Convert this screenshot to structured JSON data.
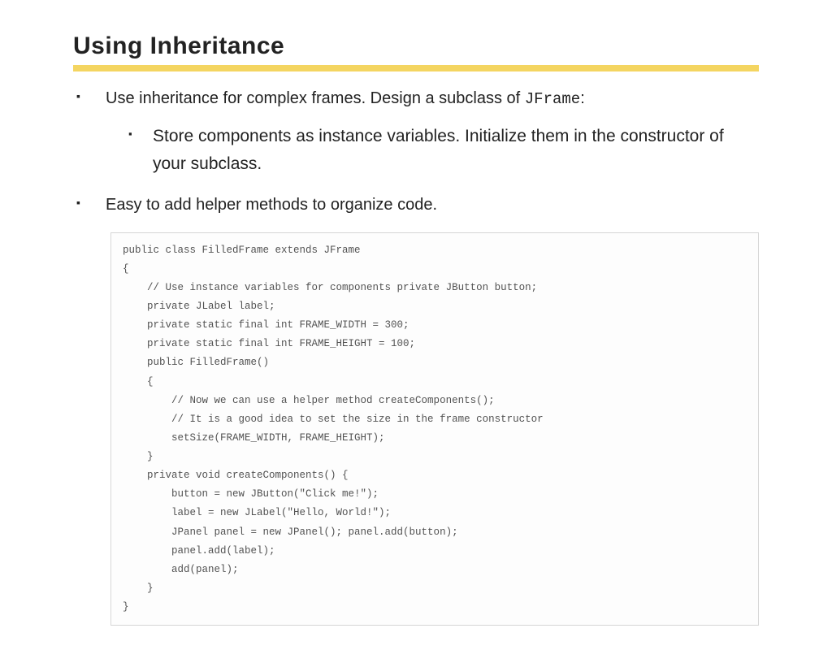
{
  "title": "Using Inheritance",
  "bullets": {
    "b1_pre": "Use inheritance for complex frames.  Design a subclass of ",
    "b1_code": "JFrame",
    "b1_post": ":",
    "b1_sub": "Store components as instance variables.  Initialize them in the constructor of your  subclass.",
    "b2": "Easy to add helper methods to organize code."
  },
  "code": "public class FilledFrame extends JFrame\n{\n    // Use instance variables for components private JButton button;\n    private JLabel label;\n    private static final int FRAME_WIDTH = 300;\n    private static final int FRAME_HEIGHT = 100;\n    public FilledFrame()\n    {\n        // Now we can use a helper method createComponents();\n        // It is a good idea to set the size in the frame constructor\n        setSize(FRAME_WIDTH, FRAME_HEIGHT);\n    }\n    private void createComponents() {\n        button = new JButton(\"Click me!\");\n        label = new JLabel(\"Hello, World!\");\n        JPanel panel = new JPanel(); panel.add(button);\n        panel.add(label);\n        add(panel);\n    }\n}"
}
